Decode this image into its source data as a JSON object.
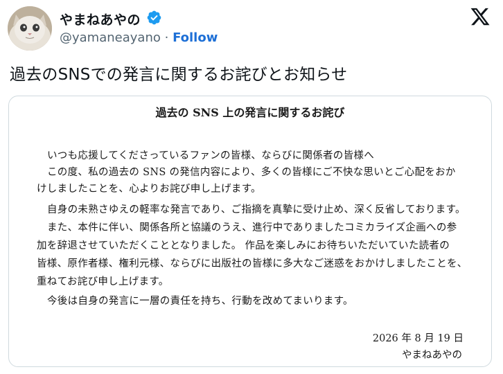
{
  "author": {
    "display_name": "やまねあやの",
    "handle": "@yamaneayano",
    "separator": "·",
    "follow_label": "Follow",
    "avatar_icon": "cat-avatar",
    "verified_icon": "verified-badge-icon",
    "verified_color": "#1d9bf0"
  },
  "platform": {
    "logo_icon": "x-logo-icon"
  },
  "tweet": {
    "text": "過去のSNSでの発言に関するお詫びとお知らせ"
  },
  "document": {
    "title": "過去の SNS 上の発言に関するお詫び",
    "lines": [
      "いつも応援してくださっているファンの皆様、ならびに関係者の皆様へ",
      "この度、私の過去の SNS の発信内容により、多くの皆様にご不快な思いとご心配をおか",
      "けしましたことを、心よりお詫び申し上げます。",
      "自身の未熟さゆえの軽率な発言であり、ご指摘を真摯に受け止め、深く反省しております。",
      "また、本件に伴い、関係各所と協議のうえ、進行中でありましたコミカライズ企画への参",
      "加を辞退させていただくこととなりました。 作品を楽しみにお待ちいただいていた読者の",
      "皆様、原作者様、権利元様、ならびに出版社の皆様に多大なご迷惑をおかけしましたことを、",
      "重ねてお詫び申し上げます。",
      "今後は自身の発言に一層の責任を持ち、行動を改めてまいります。"
    ],
    "date": "2026 年 8 月 19 日",
    "signature": "やまねあやの"
  }
}
